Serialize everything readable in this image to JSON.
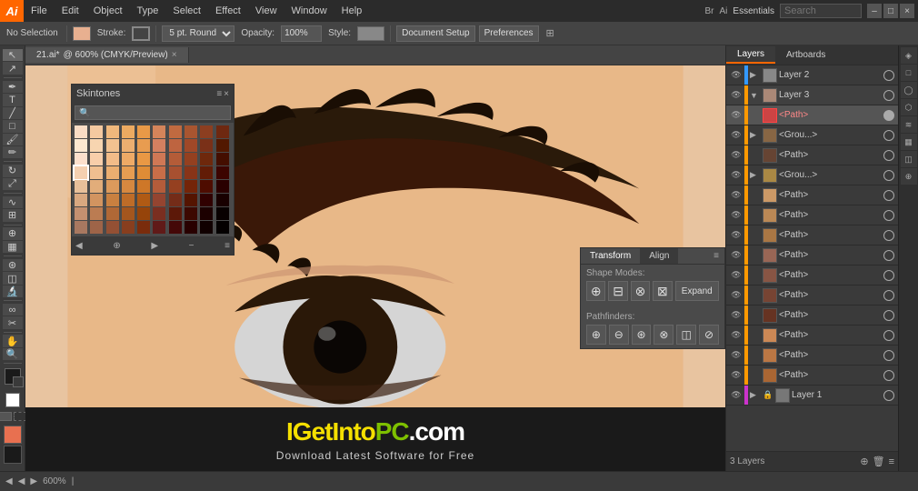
{
  "app": {
    "logo": "Ai",
    "title": "Adobe Illustrator"
  },
  "menu": {
    "items": [
      "File",
      "Edit",
      "Object",
      "Type",
      "Select",
      "Effect",
      "View",
      "Window",
      "Help"
    ],
    "right_buttons": [
      "Br",
      "Ai"
    ],
    "workspace": "Essentials",
    "window_controls": [
      "–",
      "□",
      "×"
    ]
  },
  "toolbar": {
    "selection_label": "No Selection",
    "stroke_label": "Stroke:",
    "stroke_value": "",
    "brush_label": "5 pt. Round",
    "opacity_label": "Opacity:",
    "opacity_value": "100%",
    "style_label": "Style:",
    "document_setup": "Document Setup",
    "preferences": "Preferences"
  },
  "tab": {
    "name": "21.ai*",
    "info": "@ 600% (CMYK/Preview)"
  },
  "skintones_panel": {
    "title": "Skintones",
    "search_placeholder": "🔍",
    "swatches": [
      "#f9dcc4",
      "#f4c9a0",
      "#f0b87c",
      "#ecaa61",
      "#e89947",
      "#d4845a",
      "#c06a40",
      "#a85530",
      "#8c3e20",
      "#6e2810",
      "#fce8d0",
      "#f7d5b0",
      "#f2c290",
      "#edaf70",
      "#e89c50",
      "#d48060",
      "#be6440",
      "#a04828",
      "#7a3018",
      "#521800",
      "#fde0cc",
      "#f8ceaa",
      "#f3bc88",
      "#eeaa66",
      "#e99844",
      "#d07855",
      "#b45c38",
      "#944020",
      "#6e280c",
      "#440e00",
      "#f5d0b0",
      "#f0bf90",
      "#ebae70",
      "#e69d52",
      "#df8c36",
      "#c86e48",
      "#a85030",
      "#883418",
      "#621c06",
      "#3c0400",
      "#e8c09a",
      "#e2ad7a",
      "#dc9a5c",
      "#d68840",
      "#ce7728",
      "#b45c3a",
      "#954020",
      "#742408",
      "#4e0c00",
      "#2a0000",
      "#d9a880",
      "#d29460",
      "#c98040",
      "#be6c28",
      "#b05a14",
      "#944430",
      "#742c18",
      "#541400",
      "#300000",
      "#180000",
      "#c49070",
      "#bb7c52",
      "#b06836",
      "#a4561e",
      "#96440a",
      "#7a2e20",
      "#5c1808",
      "#3c0800",
      "#1c0000",
      "#080000",
      "#a87860",
      "#9e6448",
      "#945034",
      "#883e1e",
      "#7a2c0c",
      "#601a18",
      "#440808",
      "#280000",
      "#100000",
      "#040000"
    ],
    "footer_items": [
      "◀",
      "▶",
      "⊕",
      "−",
      "≡"
    ]
  },
  "transform_panel": {
    "tabs": [
      "Transform",
      "Align"
    ],
    "shape_modes_label": "Shape Modes:",
    "pathfinders_label": "Pathfinders:",
    "shape_mode_icons": [
      "▣",
      "◫",
      "⊟",
      "⊠"
    ],
    "pathfinder_icons": [
      "⊕",
      "⊖",
      "⊗",
      "⊘"
    ]
  },
  "layers_panel": {
    "tabs": [
      "Layers",
      "Artboards"
    ],
    "layers": [
      {
        "name": "Layer 2",
        "color": "#3399ff",
        "expanded": false,
        "visible": true,
        "locked": false,
        "level": 0
      },
      {
        "name": "Layer 3",
        "color": "#ff9900",
        "expanded": true,
        "visible": true,
        "locked": false,
        "level": 0
      },
      {
        "name": "<Path>",
        "color": "#ff9900",
        "expanded": false,
        "visible": true,
        "locked": false,
        "level": 1,
        "selected": true,
        "thumb": "#c44"
      },
      {
        "name": "<Grou...>",
        "color": "#ff9900",
        "expanded": false,
        "visible": true,
        "locked": false,
        "level": 1,
        "thumb": "#864"
      },
      {
        "name": "<Path>",
        "color": "#ff9900",
        "expanded": false,
        "visible": true,
        "locked": false,
        "level": 1,
        "thumb": "#643"
      },
      {
        "name": "<Grou...>",
        "color": "#ff9900",
        "expanded": false,
        "visible": true,
        "locked": false,
        "level": 1,
        "thumb": "#a84"
      },
      {
        "name": "<Path>",
        "color": "#ff9900",
        "expanded": false,
        "visible": true,
        "locked": false,
        "level": 1,
        "thumb": "#c96"
      },
      {
        "name": "<Path>",
        "color": "#ff9900",
        "expanded": false,
        "visible": true,
        "locked": false,
        "level": 1,
        "thumb": "#b85"
      },
      {
        "name": "<Path>",
        "color": "#ff9900",
        "expanded": false,
        "visible": true,
        "locked": false,
        "level": 1,
        "thumb": "#a74"
      },
      {
        "name": "<Path>",
        "color": "#ff9900",
        "expanded": false,
        "visible": true,
        "locked": false,
        "level": 1,
        "thumb": "#965"
      },
      {
        "name": "<Path>",
        "color": "#ff9900",
        "expanded": false,
        "visible": true,
        "locked": false,
        "level": 1,
        "thumb": "#854"
      },
      {
        "name": "<Path>",
        "color": "#ff9900",
        "expanded": false,
        "visible": true,
        "locked": false,
        "level": 1,
        "thumb": "#743"
      },
      {
        "name": "<Path>",
        "color": "#ff9900",
        "expanded": false,
        "visible": true,
        "locked": false,
        "level": 1,
        "thumb": "#632"
      },
      {
        "name": "<Path>",
        "color": "#ff9900",
        "expanded": false,
        "visible": true,
        "locked": false,
        "level": 1,
        "thumb": "#c85"
      },
      {
        "name": "<Path>",
        "color": "#ff9900",
        "expanded": false,
        "visible": true,
        "locked": false,
        "level": 1,
        "thumb": "#b74"
      },
      {
        "name": "<Path>",
        "color": "#ff9900",
        "expanded": false,
        "visible": true,
        "locked": false,
        "level": 1,
        "thumb": "#a63"
      },
      {
        "name": "<Path>",
        "color": "#ff9900",
        "expanded": false,
        "visible": true,
        "locked": false,
        "level": 1,
        "thumb": "#963"
      },
      {
        "name": "Layer 1",
        "color": "#cc33cc",
        "expanded": false,
        "visible": true,
        "locked": true,
        "level": 0
      }
    ],
    "footer": "3 Layers",
    "footer_buttons": [
      "⊕",
      "⊗",
      "≡"
    ]
  },
  "status_bar": {
    "zoom": "600%",
    "info": ""
  },
  "watermark": {
    "text_yellow": "IGetInto",
    "text_green": "PC",
    "text_white": ".com",
    "subtitle": "Download Latest Software for Free"
  },
  "tools": [
    "◈",
    "↖",
    "↕",
    "✏",
    "✒",
    "⌖",
    "◻",
    "✂",
    "⊗",
    "🖐",
    "🔍",
    "⬜",
    "◯",
    "⬡",
    "≋",
    "∿",
    "⬜",
    "⬜",
    "🎨",
    "📝",
    "🔤"
  ]
}
